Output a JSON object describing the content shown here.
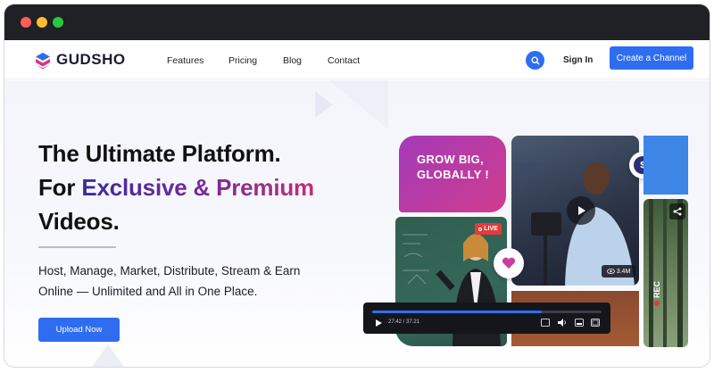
{
  "window": {
    "controls": [
      "close",
      "minimize",
      "maximize"
    ],
    "colors": {
      "close": "#ff5f57",
      "minimize": "#febc2e",
      "maximize": "#28c840",
      "bar": "#202124"
    }
  },
  "nav": {
    "brand": "GUDSHO",
    "links": [
      "Features",
      "Pricing",
      "Blog",
      "Contact"
    ],
    "signin": "Sign In",
    "cta": "Create a Channel",
    "accent": "#2f6df0"
  },
  "hero": {
    "line1": "The Ultimate Platform.",
    "line2_prefix": "For ",
    "line2_highlight": "Exclusive & Premium",
    "line3": "Videos.",
    "desc_line1": "Host, Manage, Market, Distribute, Stream & Earn",
    "desc_line2": "Online — Unlimited and All in One Place.",
    "button": "Upload Now"
  },
  "media": {
    "grow_text": "GROW BIG, GLOBALLY !",
    "live_badge": "LIVE",
    "views": "3.4M",
    "rec": "REC",
    "player_time": "27:42 / 37:21",
    "progress": 0.74
  }
}
